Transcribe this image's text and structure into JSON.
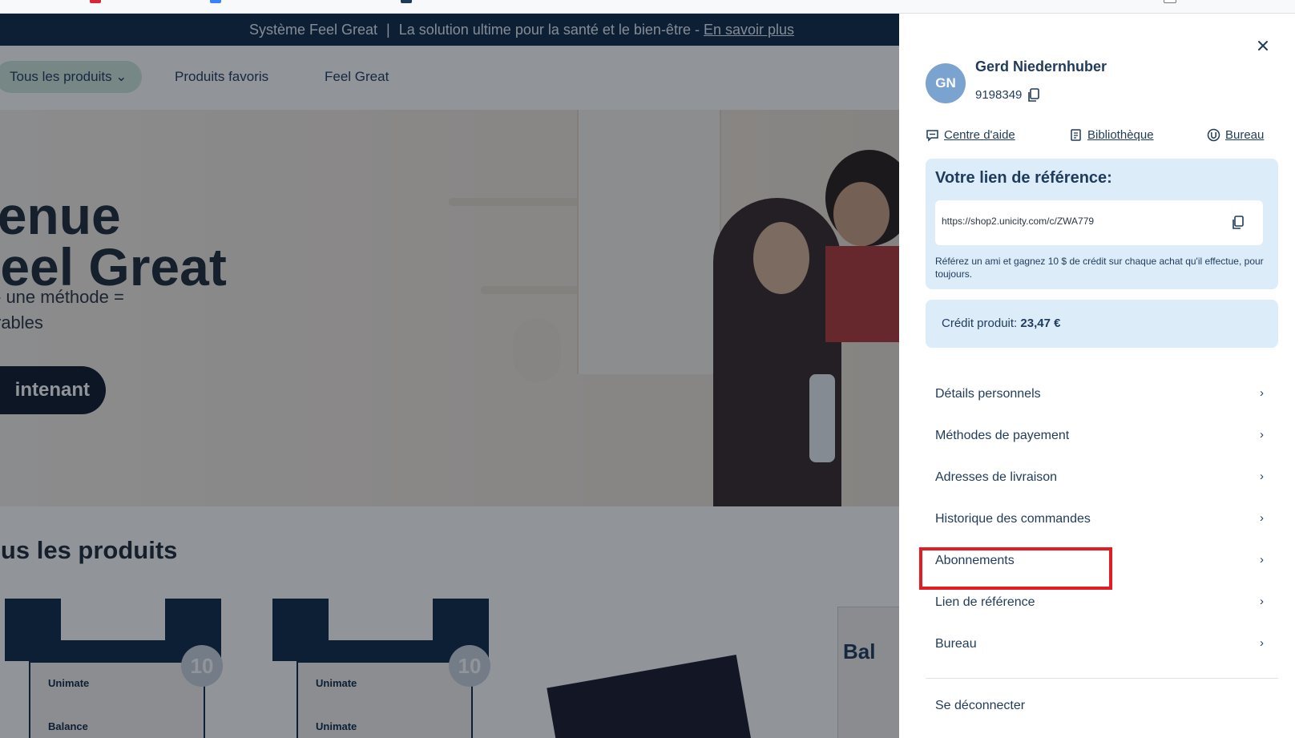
{
  "colors": {
    "panel_bg": "#ffffff",
    "text_primary": "#1f3b5c",
    "info_box_bg": "#dcecf8",
    "avatar_bg": "#7aa3cf",
    "highlight_border": "#e11c23",
    "announcement_bg": "#0f2a4a",
    "pill_bg": "#cfe8dc"
  },
  "background_page": {
    "announcement": {
      "text": "Système Feel Great",
      "separator": "|",
      "tagline": "La solution ultime pour la santé et le bien-être -",
      "link": "En savoir plus"
    },
    "nav": {
      "all_products": "Tous les produits ⌄",
      "favorites": "Produits favoris",
      "feel_great": "Feel Great"
    },
    "hero": {
      "title_line1": "venue",
      "title_line2": "Feel Great",
      "sub_line1": "- une méthode =",
      "sub_line2": "rables",
      "button": "intenant"
    },
    "section_title": "ous les produits",
    "products": [
      {
        "label_top": "Unimate",
        "label_bottom": "Balance",
        "badge": "10"
      },
      {
        "label_top": "Unimate",
        "label_bottom": "Unimate",
        "badge": "10"
      }
    ],
    "partial_product_text": "Bal"
  },
  "panel": {
    "close_icon": "close-icon",
    "user": {
      "initials": "GN",
      "name": "Gerd Niedernhuber",
      "id": "9198349"
    },
    "quick_links": [
      {
        "label": "Centre d'aide",
        "icon": "chat-bubble-icon"
      },
      {
        "label": "Bibliothèque",
        "icon": "document-icon"
      },
      {
        "label": "Bureau",
        "icon": "unicity-logo-icon"
      }
    ],
    "referral": {
      "title": "Votre lien de référence:",
      "url": "https://shop2.unicity.com/c/ZWA779",
      "description": "Référez un ami et gagnez 10 $ de crédit sur chaque achat qu'il effectue, pour toujours."
    },
    "credit": {
      "label": "Crédit produit:",
      "amount": "23,47 €"
    },
    "menu": [
      {
        "label": "Détails personnels"
      },
      {
        "label": "Méthodes de payement"
      },
      {
        "label": "Adresses de livraison"
      },
      {
        "label": "Historique des commandes"
      },
      {
        "label": "Abonnements",
        "highlighted": true
      },
      {
        "label": "Lien de référence"
      },
      {
        "label": "Bureau"
      }
    ],
    "chevron": "›",
    "logout": "Se déconnecter"
  }
}
